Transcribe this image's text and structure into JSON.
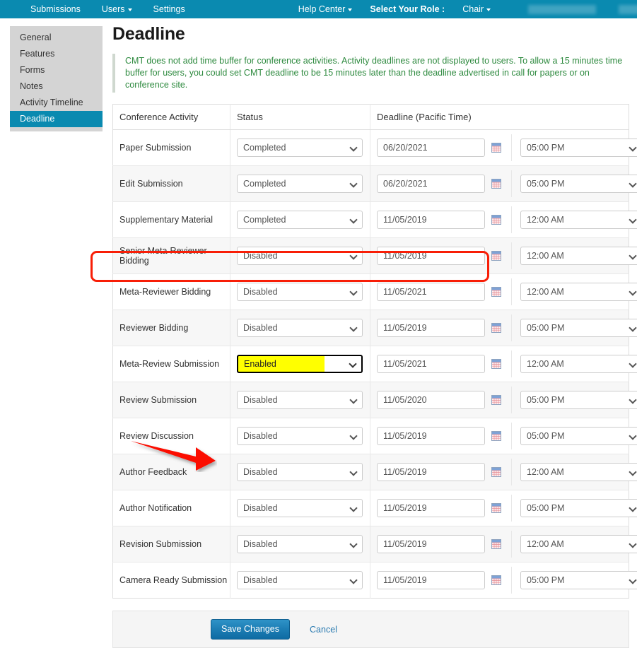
{
  "navbar": {
    "left_items": [
      {
        "label": "Submissions",
        "caret": false
      },
      {
        "label": "Users",
        "caret": true
      },
      {
        "label": "Settings",
        "caret": false
      }
    ],
    "help_center": "Help Center",
    "role_label": "Select Your Role :",
    "role_value": "Chair",
    "background_color": "#0a8ab0"
  },
  "sidebar": {
    "items": [
      {
        "label": "General",
        "active": false
      },
      {
        "label": "Features",
        "active": false
      },
      {
        "label": "Forms",
        "active": false
      },
      {
        "label": "Notes",
        "active": false
      },
      {
        "label": "Activity Timeline",
        "active": false
      },
      {
        "label": "Deadline",
        "active": true
      }
    ]
  },
  "main": {
    "title": "Deadline",
    "notice": "CMT does not add time buffer for conference activities. Activity deadlines are not displayed to users. To allow a 15 minutes time buffer for users, you could set CMT deadline to be 15 minutes later than the deadline advertised in call for papers or on conference site.",
    "notice_color": "#2e8a3f",
    "table": {
      "headers": [
        "Conference Activity",
        "Status",
        "Deadline (Pacific Time)"
      ],
      "rows": [
        {
          "activity": "Paper Submission",
          "status": "Completed",
          "date": "06/20/2021",
          "time": "05:00 PM",
          "highlighted": false
        },
        {
          "activity": "Edit Submission",
          "status": "Completed",
          "date": "06/20/2021",
          "time": "05:00 PM",
          "highlighted": false
        },
        {
          "activity": "Supplementary Material",
          "status": "Completed",
          "date": "11/05/2019",
          "time": "12:00 AM",
          "highlighted": false
        },
        {
          "activity": "Senior Meta-Reviewer Bidding",
          "status": "Disabled",
          "date": "11/05/2019",
          "time": "12:00 AM",
          "highlighted": false
        },
        {
          "activity": "Meta-Reviewer Bidding",
          "status": "Disabled",
          "date": "11/05/2021",
          "time": "12:00 AM",
          "highlighted": false
        },
        {
          "activity": "Reviewer Bidding",
          "status": "Disabled",
          "date": "11/05/2019",
          "time": "05:00 PM",
          "highlighted": false
        },
        {
          "activity": "Meta-Review Submission",
          "status": "Enabled",
          "date": "11/05/2021",
          "time": "12:00 AM",
          "highlighted": true
        },
        {
          "activity": "Review Submission",
          "status": "Disabled",
          "date": "11/05/2020",
          "time": "05:00 PM",
          "highlighted": false
        },
        {
          "activity": "Review Discussion",
          "status": "Disabled",
          "date": "11/05/2019",
          "time": "05:00 PM",
          "highlighted": false
        },
        {
          "activity": "Author Feedback",
          "status": "Disabled",
          "date": "11/05/2019",
          "time": "12:00 AM",
          "highlighted": false
        },
        {
          "activity": "Author Notification",
          "status": "Disabled",
          "date": "11/05/2019",
          "time": "05:00 PM",
          "highlighted": false
        },
        {
          "activity": "Revision Submission",
          "status": "Disabled",
          "date": "11/05/2019",
          "time": "12:00 AM",
          "highlighted": false
        },
        {
          "activity": "Camera Ready Submission",
          "status": "Disabled",
          "date": "11/05/2019",
          "time": "05:00 PM",
          "highlighted": false
        }
      ],
      "status_options": [
        "Completed",
        "Enabled",
        "Disabled"
      ],
      "time_options": [
        "12:00 AM",
        "05:00 PM"
      ]
    }
  },
  "footer": {
    "save_label": "Save Changes",
    "cancel_label": "Cancel"
  },
  "annotations": {
    "highlight_color": "#f81e07",
    "box_target": "Meta-Review Submission row",
    "arrow_target": "Save Changes button"
  }
}
